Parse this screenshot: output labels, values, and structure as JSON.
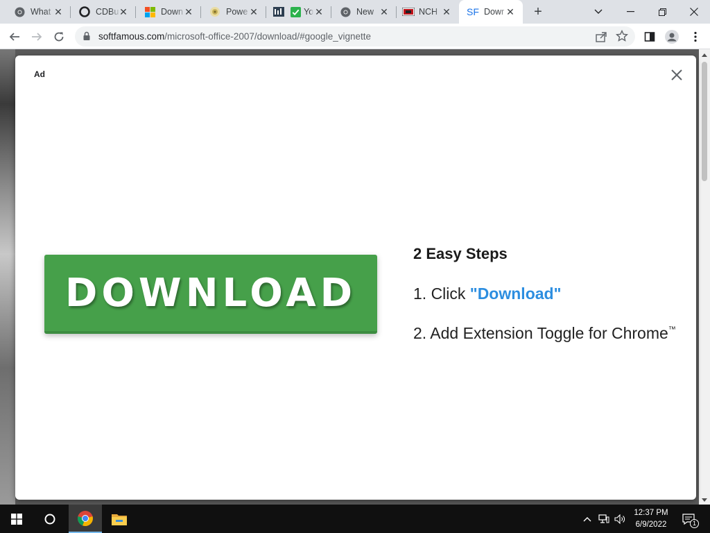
{
  "browser": {
    "tabs": [
      {
        "title": "What",
        "favicon": "chrome-icon"
      },
      {
        "title": "CDBu",
        "favicon": "opera-icon"
      },
      {
        "title": "Down",
        "favicon": "microsoft-icon"
      },
      {
        "title": "Powe",
        "favicon": "software-icon"
      },
      {
        "title": "Yo",
        "favicon": "checkmark-icon"
      },
      {
        "title": "New",
        "favicon": "chrome-icon"
      },
      {
        "title": "NCH",
        "favicon": "nch-icon"
      },
      {
        "title": "Dowr",
        "favicon": "sf-icon",
        "favicon_text": "SF",
        "active": true
      }
    ],
    "url": {
      "domain": "softfamous.com",
      "path": "/microsoft-office-2007/download/#google_vignette"
    }
  },
  "ad": {
    "label": "Ad",
    "download_button_label": "DOWNLOAD",
    "steps_title": "2 Easy Steps",
    "step1_prefix": "1. Click ",
    "step1_link": "\"Download\"",
    "step2_text": "2. Add Extension Toggle for Chrome",
    "step2_trademark": "™",
    "colors": {
      "button_green": "#46a04a",
      "link_blue": "#2d8ee0"
    }
  },
  "taskbar": {
    "time": "12:37 PM",
    "date": "6/9/2022",
    "notification_count": "1"
  }
}
